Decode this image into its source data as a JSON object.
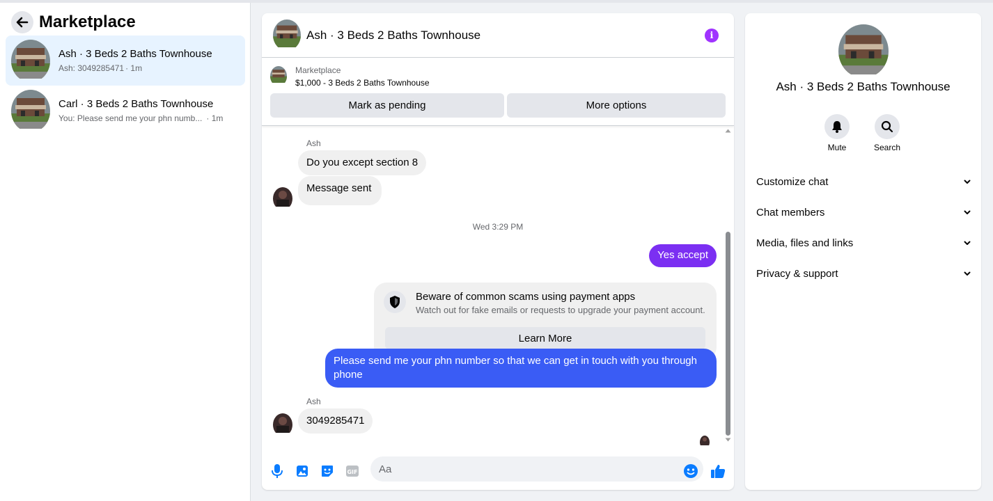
{
  "colors": {
    "accent_purple": "#a033ff",
    "out_bubble_purple": "#7b2ff2",
    "out_bubble_blue": "#3a5cf5",
    "active_row": "#e7f3ff",
    "icon_blue": "#0a7cff"
  },
  "sidebar": {
    "title": "Marketplace",
    "back_icon": "arrow-left-icon",
    "conversations": [
      {
        "name": "Ash · 3 Beds 2 Baths Townhouse",
        "preview": "Ash: 3049285471",
        "time": "· 1m",
        "active": true
      },
      {
        "name": "Carl · 3 Beds 2 Baths Townhouse",
        "preview": "You: Please send me your phn numb...",
        "time": "· 1m",
        "active": false
      }
    ]
  },
  "chat": {
    "title": "Ash · 3 Beds 2 Baths Townhouse",
    "info_icon": "info-icon",
    "listing": {
      "label": "Marketplace",
      "price_title": "$1,000 - 3 Beds 2 Baths Townhouse",
      "pending_button": "Mark as pending",
      "options_button": "More options"
    },
    "messages": {
      "sender1": "Ash",
      "msg1": "Do you except section 8",
      "msg2": "Message sent",
      "timestamp": "Wed 3:29 PM",
      "msg3": "Yes accept",
      "scam_title": "Beware of common scams using payment apps",
      "scam_sub": "Watch out for fake emails or requests to upgrade your payment account.",
      "learn_more": "Learn More",
      "msg4_line1": "Please send me your phn number so that we can get in touch with you through",
      "msg4_line2": "phone",
      "sender2": "Ash",
      "msg5": "3049285471"
    },
    "composer": {
      "placeholder": "Aa",
      "icons": [
        "microphone-icon",
        "photo-icon",
        "sticker-icon",
        "gif-icon",
        "emoji-icon",
        "thumbs-up-icon"
      ],
      "gif_label": "GIF"
    }
  },
  "info_panel": {
    "name": "Ash · 3 Beds 2 Baths Townhouse",
    "actions": [
      {
        "label": "Mute",
        "icon": "bell-icon"
      },
      {
        "label": "Search",
        "icon": "search-icon"
      }
    ],
    "sections": [
      "Customize chat",
      "Chat members",
      "Media, files and links",
      "Privacy & support"
    ]
  }
}
